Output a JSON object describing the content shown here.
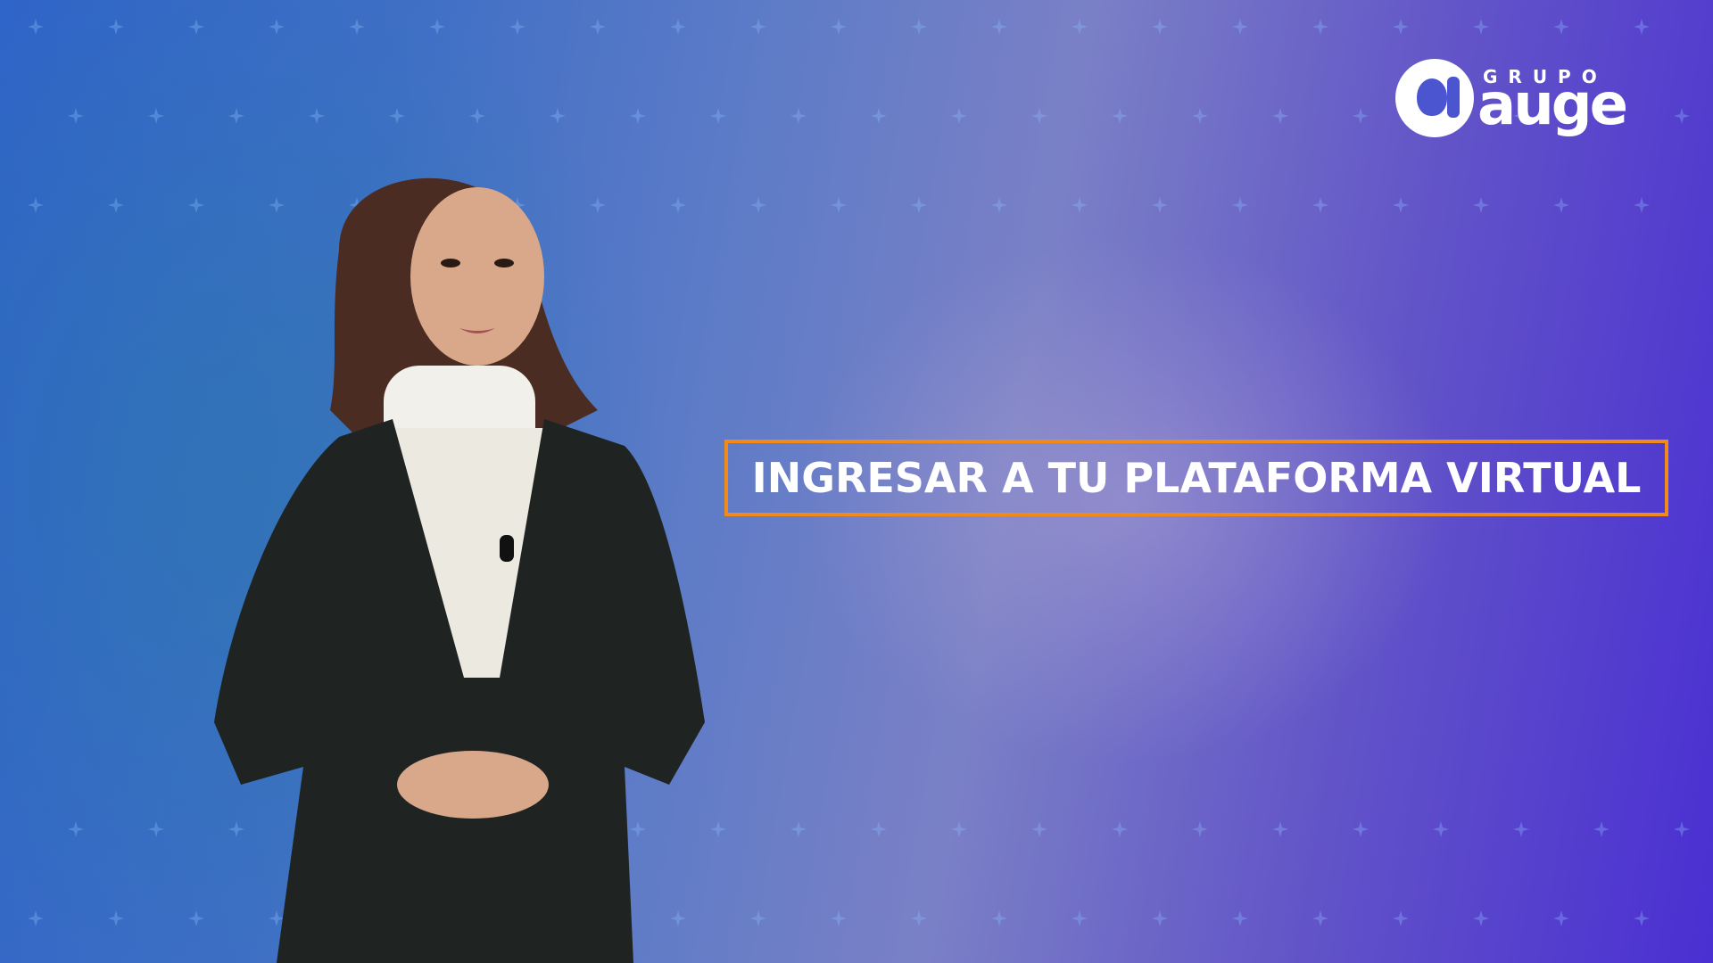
{
  "logo": {
    "small_text": "GRUPO",
    "big_text": "auge"
  },
  "title": {
    "text": "INGRESAR A TU PLATAFORMA VIRTUAL"
  },
  "colors": {
    "accent_border": "#f28a1a",
    "text": "#ffffff",
    "jacket": "#1f2422",
    "sweater": "#f2f0ea"
  },
  "icons": {
    "logo_mark": "auge-logo-icon",
    "microphone": "lapel-microphone-icon"
  }
}
